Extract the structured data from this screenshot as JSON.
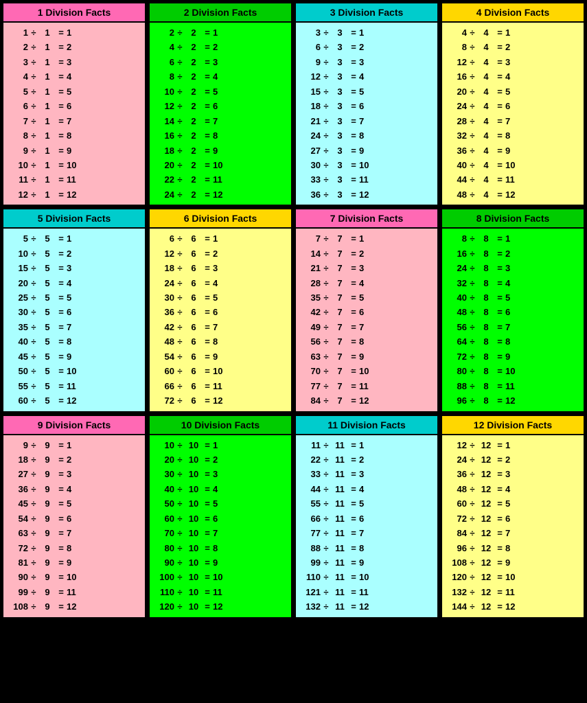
{
  "sections": [
    {
      "title": "1 Division Facts",
      "divisor": 1,
      "bgBody": "#FFB6C1",
      "bgHeader": "#FF69B4",
      "facts": [
        [
          1,
          1,
          1
        ],
        [
          2,
          1,
          2
        ],
        [
          3,
          1,
          3
        ],
        [
          4,
          1,
          4
        ],
        [
          5,
          1,
          5
        ],
        [
          6,
          1,
          6
        ],
        [
          7,
          1,
          7
        ],
        [
          8,
          1,
          8
        ],
        [
          9,
          1,
          9
        ],
        [
          10,
          1,
          10
        ],
        [
          11,
          1,
          11
        ],
        [
          12,
          1,
          12
        ]
      ]
    },
    {
      "title": "2 Division Facts",
      "divisor": 2,
      "bgBody": "#00FF00",
      "bgHeader": "#00CC00",
      "facts": [
        [
          2,
          2,
          1
        ],
        [
          4,
          2,
          2
        ],
        [
          6,
          2,
          3
        ],
        [
          8,
          2,
          4
        ],
        [
          10,
          2,
          5
        ],
        [
          12,
          2,
          6
        ],
        [
          14,
          2,
          7
        ],
        [
          16,
          2,
          8
        ],
        [
          18,
          2,
          9
        ],
        [
          20,
          2,
          10
        ],
        [
          22,
          2,
          11
        ],
        [
          24,
          2,
          12
        ]
      ]
    },
    {
      "title": "3 Division Facts",
      "divisor": 3,
      "bgBody": "#AAFFFF",
      "bgHeader": "#00CCCC",
      "facts": [
        [
          3,
          3,
          1
        ],
        [
          6,
          3,
          2
        ],
        [
          9,
          3,
          3
        ],
        [
          12,
          3,
          4
        ],
        [
          15,
          3,
          5
        ],
        [
          18,
          3,
          6
        ],
        [
          21,
          3,
          7
        ],
        [
          24,
          3,
          8
        ],
        [
          27,
          3,
          9
        ],
        [
          30,
          3,
          10
        ],
        [
          33,
          3,
          11
        ],
        [
          36,
          3,
          12
        ]
      ]
    },
    {
      "title": "4 Division Facts",
      "divisor": 4,
      "bgBody": "#FFFF88",
      "bgHeader": "#FFD700",
      "facts": [
        [
          4,
          4,
          1
        ],
        [
          8,
          4,
          2
        ],
        [
          12,
          4,
          3
        ],
        [
          16,
          4,
          4
        ],
        [
          20,
          4,
          5
        ],
        [
          24,
          4,
          6
        ],
        [
          28,
          4,
          7
        ],
        [
          32,
          4,
          8
        ],
        [
          36,
          4,
          9
        ],
        [
          40,
          4,
          10
        ],
        [
          44,
          4,
          11
        ],
        [
          48,
          4,
          12
        ]
      ]
    },
    {
      "title": "5 Division Facts",
      "divisor": 5,
      "bgBody": "#AAFFFF",
      "bgHeader": "#00CCCC",
      "facts": [
        [
          5,
          5,
          1
        ],
        [
          10,
          5,
          2
        ],
        [
          15,
          5,
          3
        ],
        [
          20,
          5,
          4
        ],
        [
          25,
          5,
          5
        ],
        [
          30,
          5,
          6
        ],
        [
          35,
          5,
          7
        ],
        [
          40,
          5,
          8
        ],
        [
          45,
          5,
          9
        ],
        [
          50,
          5,
          10
        ],
        [
          55,
          5,
          11
        ],
        [
          60,
          5,
          12
        ]
      ]
    },
    {
      "title": "6 Division Facts",
      "divisor": 6,
      "bgBody": "#FFFF88",
      "bgHeader": "#FFD700",
      "facts": [
        [
          6,
          6,
          1
        ],
        [
          12,
          6,
          2
        ],
        [
          18,
          6,
          3
        ],
        [
          24,
          6,
          4
        ],
        [
          30,
          6,
          5
        ],
        [
          36,
          6,
          6
        ],
        [
          42,
          6,
          7
        ],
        [
          48,
          6,
          8
        ],
        [
          54,
          6,
          9
        ],
        [
          60,
          6,
          10
        ],
        [
          66,
          6,
          11
        ],
        [
          72,
          6,
          12
        ]
      ]
    },
    {
      "title": "7 Division Facts",
      "divisor": 7,
      "bgBody": "#FFB6C1",
      "bgHeader": "#FF69B4",
      "facts": [
        [
          7,
          7,
          1
        ],
        [
          14,
          7,
          2
        ],
        [
          21,
          7,
          3
        ],
        [
          28,
          7,
          4
        ],
        [
          35,
          7,
          5
        ],
        [
          42,
          7,
          6
        ],
        [
          49,
          7,
          7
        ],
        [
          56,
          7,
          8
        ],
        [
          63,
          7,
          9
        ],
        [
          70,
          7,
          10
        ],
        [
          77,
          7,
          11
        ],
        [
          84,
          7,
          12
        ]
      ]
    },
    {
      "title": "8 Division Facts",
      "divisor": 8,
      "bgBody": "#00FF00",
      "bgHeader": "#00CC00",
      "facts": [
        [
          8,
          8,
          1
        ],
        [
          16,
          8,
          2
        ],
        [
          24,
          8,
          3
        ],
        [
          32,
          8,
          4
        ],
        [
          40,
          8,
          5
        ],
        [
          48,
          8,
          6
        ],
        [
          56,
          8,
          7
        ],
        [
          64,
          8,
          8
        ],
        [
          72,
          8,
          9
        ],
        [
          80,
          8,
          10
        ],
        [
          88,
          8,
          11
        ],
        [
          96,
          8,
          12
        ]
      ]
    },
    {
      "title": "9 Division Facts",
      "divisor": 9,
      "bgBody": "#FFB6C1",
      "bgHeader": "#FF69B4",
      "facts": [
        [
          9,
          9,
          1
        ],
        [
          18,
          9,
          2
        ],
        [
          27,
          9,
          3
        ],
        [
          36,
          9,
          4
        ],
        [
          45,
          9,
          5
        ],
        [
          54,
          9,
          6
        ],
        [
          63,
          9,
          7
        ],
        [
          72,
          9,
          8
        ],
        [
          81,
          9,
          9
        ],
        [
          90,
          9,
          10
        ],
        [
          99,
          9,
          11
        ],
        [
          108,
          9,
          12
        ]
      ]
    },
    {
      "title": "10 Division Facts",
      "divisor": 10,
      "bgBody": "#00FF00",
      "bgHeader": "#00CC00",
      "facts": [
        [
          10,
          10,
          1
        ],
        [
          20,
          10,
          2
        ],
        [
          30,
          10,
          3
        ],
        [
          40,
          10,
          4
        ],
        [
          50,
          10,
          5
        ],
        [
          60,
          10,
          6
        ],
        [
          70,
          10,
          7
        ],
        [
          80,
          10,
          8
        ],
        [
          90,
          10,
          9
        ],
        [
          100,
          10,
          10
        ],
        [
          110,
          10,
          11
        ],
        [
          120,
          10,
          12
        ]
      ]
    },
    {
      "title": "11 Division Facts",
      "divisor": 11,
      "bgBody": "#AAFFFF",
      "bgHeader": "#00CCCC",
      "facts": [
        [
          11,
          11,
          1
        ],
        [
          22,
          11,
          2
        ],
        [
          33,
          11,
          3
        ],
        [
          44,
          11,
          4
        ],
        [
          55,
          11,
          5
        ],
        [
          66,
          11,
          6
        ],
        [
          77,
          11,
          7
        ],
        [
          88,
          11,
          8
        ],
        [
          99,
          11,
          9
        ],
        [
          110,
          11,
          10
        ],
        [
          121,
          11,
          11
        ],
        [
          132,
          11,
          12
        ]
      ]
    },
    {
      "title": "12 Division Facts",
      "divisor": 12,
      "bgBody": "#FFFF88",
      "bgHeader": "#FFD700",
      "facts": [
        [
          12,
          12,
          1
        ],
        [
          24,
          12,
          2
        ],
        [
          36,
          12,
          3
        ],
        [
          48,
          12,
          4
        ],
        [
          60,
          12,
          5
        ],
        [
          72,
          12,
          6
        ],
        [
          84,
          12,
          7
        ],
        [
          96,
          12,
          8
        ],
        [
          108,
          12,
          9
        ],
        [
          120,
          12,
          10
        ],
        [
          132,
          12,
          11
        ],
        [
          144,
          12,
          12
        ]
      ]
    }
  ]
}
